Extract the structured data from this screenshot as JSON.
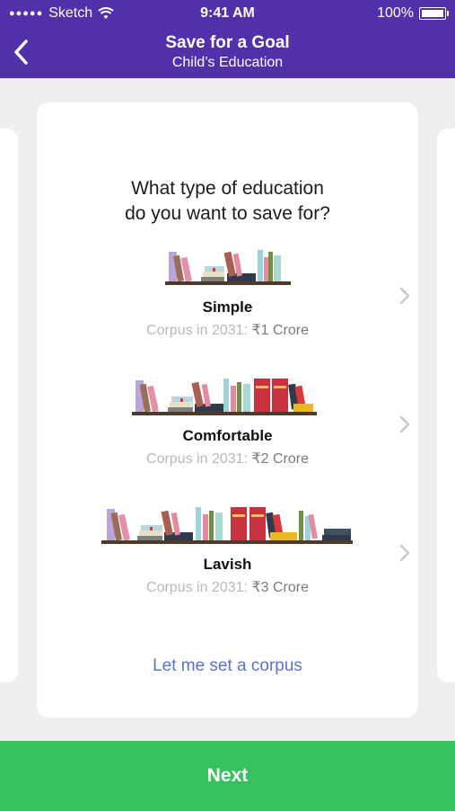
{
  "status_bar": {
    "carrier": "Sketch",
    "time": "9:41 AM",
    "battery": "100%"
  },
  "nav": {
    "title": "Save for a Goal",
    "subtitle": "Child’s Education",
    "back_icon": "chevron-left-icon"
  },
  "question": {
    "line1": "What type of education",
    "line2": "do you want to save for?"
  },
  "options": [
    {
      "title": "Simple",
      "corpus_prefix": "Corpus in 2031:",
      "corpus_value": "₹1 Crore"
    },
    {
      "title": "Comfortable",
      "corpus_prefix": "Corpus in 2031:",
      "corpus_value": "₹2 Crore"
    },
    {
      "title": "Lavish",
      "corpus_prefix": "Corpus in 2031:",
      "corpus_value": "₹3 Crore"
    }
  ],
  "link": {
    "label": "Let me set a corpus"
  },
  "footer": {
    "next_label": "Next"
  },
  "colors": {
    "header": "#5230a9",
    "next_button": "#35c25f",
    "link": "#5a73c9"
  }
}
